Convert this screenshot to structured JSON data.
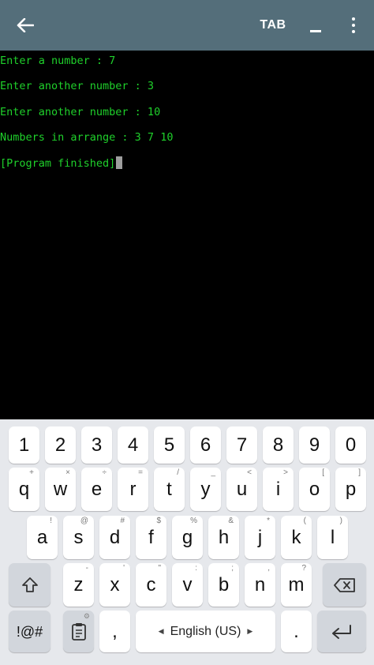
{
  "app_bar": {
    "back_icon": "arrow-left-icon",
    "tab_label": "TAB",
    "minimize_icon": "minimize-icon",
    "overflow_icon": "more-vertical-icon",
    "background_color": "#546e7a"
  },
  "console": {
    "text_color": "#1fd12b",
    "lines": [
      "Enter a number : 7",
      "Enter another number : 3",
      "Enter another number : 10",
      "Numbers in arrange : 3 7 10",
      "[Program finished]"
    ]
  },
  "keyboard": {
    "number_row": [
      "1",
      "2",
      "3",
      "4",
      "5",
      "6",
      "7",
      "8",
      "9",
      "0"
    ],
    "row1": [
      {
        "key": "q",
        "hint": "+"
      },
      {
        "key": "w",
        "hint": "×"
      },
      {
        "key": "e",
        "hint": "÷"
      },
      {
        "key": "r",
        "hint": "="
      },
      {
        "key": "t",
        "hint": "/"
      },
      {
        "key": "y",
        "hint": "_"
      },
      {
        "key": "u",
        "hint": "<"
      },
      {
        "key": "i",
        "hint": ">"
      },
      {
        "key": "o",
        "hint": "["
      },
      {
        "key": "p",
        "hint": "]"
      }
    ],
    "row2": [
      {
        "key": "a",
        "hint": "!"
      },
      {
        "key": "s",
        "hint": "@"
      },
      {
        "key": "d",
        "hint": "#"
      },
      {
        "key": "f",
        "hint": "$"
      },
      {
        "key": "g",
        "hint": "%"
      },
      {
        "key": "h",
        "hint": "&"
      },
      {
        "key": "j",
        "hint": "*"
      },
      {
        "key": "k",
        "hint": "("
      },
      {
        "key": "l",
        "hint": ")"
      }
    ],
    "row3": [
      {
        "key": "z",
        "hint": "-"
      },
      {
        "key": "x",
        "hint": "'"
      },
      {
        "key": "c",
        "hint": "\""
      },
      {
        "key": "v",
        "hint": ":"
      },
      {
        "key": "b",
        "hint": ";"
      },
      {
        "key": "n",
        "hint": ","
      },
      {
        "key": "m",
        "hint": "?"
      }
    ],
    "shift_icon": "shift-arrow-icon",
    "backspace_icon": "backspace-icon",
    "symbols_label": "!@#",
    "clipboard_icon": "clipboard-icon",
    "settings_icon": "gear-icon",
    "comma_label": ",",
    "space_label": "English (US)",
    "space_left_icon": "triangle-left-icon",
    "space_right_icon": "triangle-right-icon",
    "period_label": ".",
    "enter_icon": "enter-arrow-icon"
  }
}
